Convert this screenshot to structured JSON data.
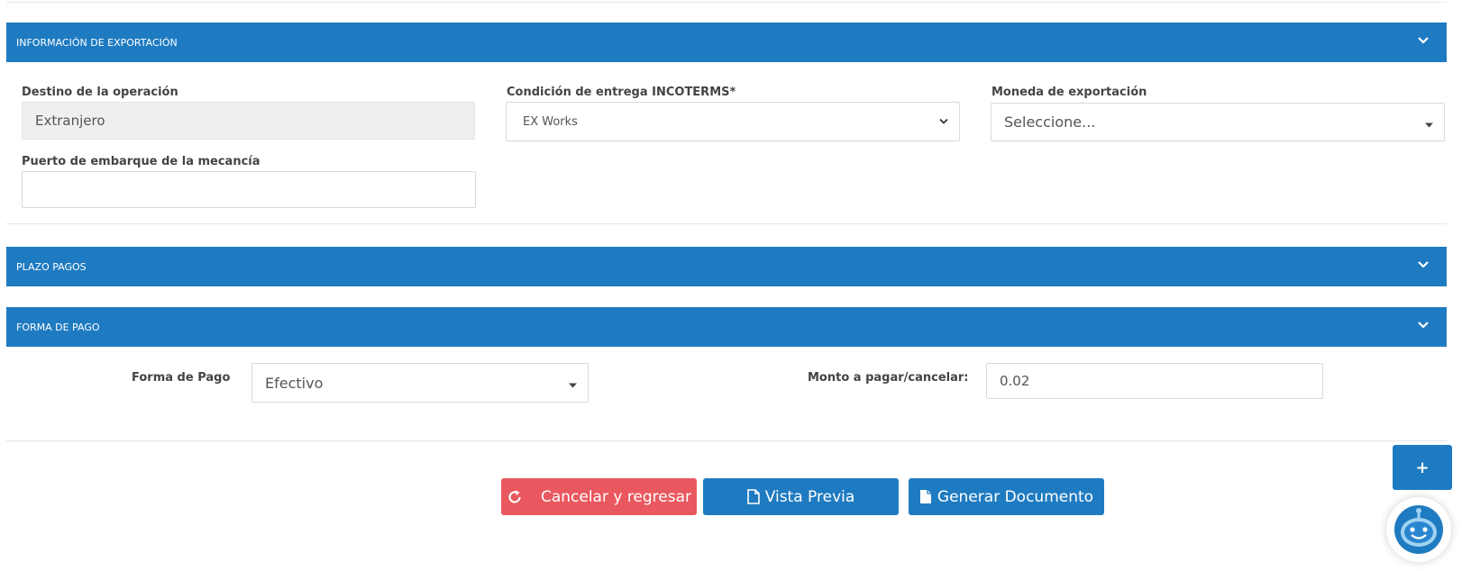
{
  "sections": {
    "export_info": {
      "title": "INFORMACIÓN DE EXPORTACIÓN"
    },
    "payment_terms": {
      "title": "PLAZO PAGOS"
    },
    "payment_method": {
      "title": "FORMA DE PAGO"
    }
  },
  "export_form": {
    "destination": {
      "label": "Destino de la operación",
      "value": "Extranjero"
    },
    "incoterms": {
      "label": "Condición de entrega INCOTERMS*",
      "value": "EX Works"
    },
    "currency": {
      "label": "Moneda de exportación",
      "value": "Seleccione..."
    },
    "port": {
      "label": "Puerto de embarque de la mecancía",
      "value": ""
    }
  },
  "payment_form": {
    "method": {
      "label": "Forma de Pago",
      "value": "Efectivo"
    },
    "amount": {
      "label": "Monto a pagar/cancelar:",
      "value": "0.02"
    }
  },
  "actions": {
    "cancel": "Cancelar y regresar",
    "preview": "Vista Previa",
    "generate": "Generar Documento",
    "add": "+"
  },
  "colors": {
    "primary": "#1f7bc1",
    "danger": "#e9585f"
  },
  "icons": [
    "chevron-down-icon",
    "caret-down-icon",
    "refresh-icon",
    "file-outline-icon",
    "file-solid-icon",
    "robot-assistant-icon"
  ]
}
